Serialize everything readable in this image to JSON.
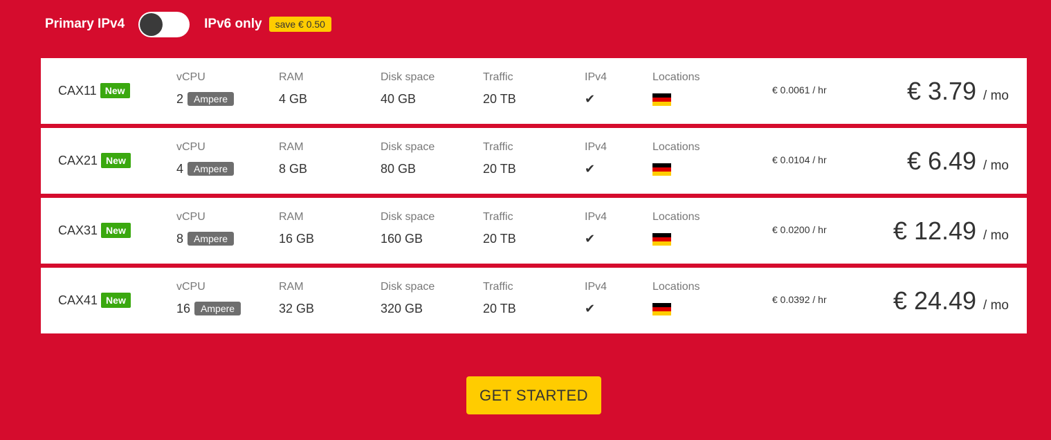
{
  "toggle": {
    "left_label": "Primary IPv4",
    "right_label": "IPv6 only",
    "save_badge": "save € 0.50",
    "state": "ipv4"
  },
  "columns": {
    "vcpu": "vCPU",
    "ram": "RAM",
    "disk": "Disk space",
    "traffic": "Traffic",
    "ipv4": "IPv4",
    "locations": "Locations"
  },
  "plans": [
    {
      "name": "CAX11",
      "badge": "New",
      "vcpu": "2",
      "cpu_type": "Ampere",
      "ram": "4 GB",
      "disk": "40 GB",
      "traffic": "20 TB",
      "ipv4": "✔",
      "location_flag": "germany-flag-icon",
      "hourly": "€ 0.0061 / hr",
      "monthly": "€ 3.79",
      "per": "/ mo"
    },
    {
      "name": "CAX21",
      "badge": "New",
      "vcpu": "4",
      "cpu_type": "Ampere",
      "ram": "8 GB",
      "disk": "80 GB",
      "traffic": "20 TB",
      "ipv4": "✔",
      "location_flag": "germany-flag-icon",
      "hourly": "€ 0.0104 / hr",
      "monthly": "€ 6.49",
      "per": "/ mo"
    },
    {
      "name": "CAX31",
      "badge": "New",
      "vcpu": "8",
      "cpu_type": "Ampere",
      "ram": "16 GB",
      "disk": "160 GB",
      "traffic": "20 TB",
      "ipv4": "✔",
      "location_flag": "germany-flag-icon",
      "hourly": "€ 0.0200 / hr",
      "monthly": "€ 12.49",
      "per": "/ mo"
    },
    {
      "name": "CAX41",
      "badge": "New",
      "vcpu": "16",
      "cpu_type": "Ampere",
      "ram": "32 GB",
      "disk": "320 GB",
      "traffic": "20 TB",
      "ipv4": "✔",
      "location_flag": "germany-flag-icon",
      "hourly": "€ 0.0392 / hr",
      "monthly": "€ 24.49",
      "per": "/ mo"
    }
  ],
  "cta": {
    "label": "GET STARTED"
  },
  "colors": {
    "background": "#d50c2d",
    "badge_new": "#3aa80f",
    "cta": "#ffcc00",
    "ampere_badge": "#6e6e6e"
  }
}
